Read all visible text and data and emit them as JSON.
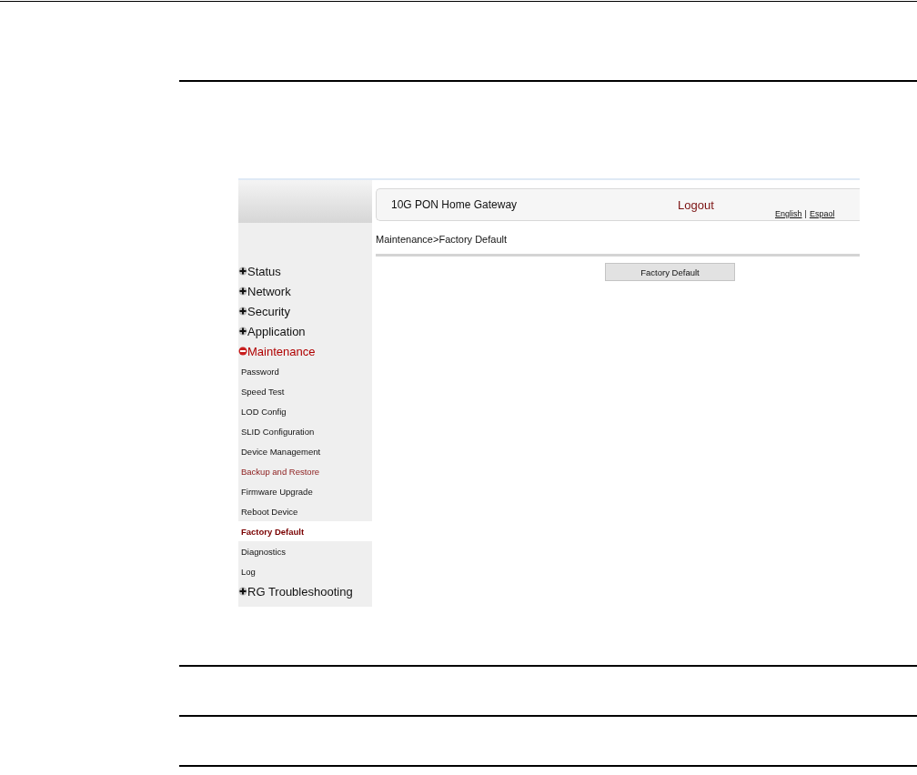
{
  "gateway": {
    "title": "10G PON Home Gateway",
    "logout": "Logout",
    "languages": [
      "English",
      "Espaol"
    ],
    "separator": "|"
  },
  "breadcrumb": "Maintenance>Factory Default",
  "menu": [
    {
      "label": "Status",
      "expanded": false
    },
    {
      "label": "Network",
      "expanded": false
    },
    {
      "label": "Security",
      "expanded": false
    },
    {
      "label": "Application",
      "expanded": false
    },
    {
      "label": "Maintenance",
      "expanded": true,
      "children": [
        {
          "label": "Password",
          "selected": false,
          "highlighted": false
        },
        {
          "label": "Speed Test",
          "selected": false,
          "highlighted": false
        },
        {
          "label": "LOD Config",
          "selected": false,
          "highlighted": false
        },
        {
          "label": "SLID Configuration",
          "selected": false,
          "highlighted": false
        },
        {
          "label": "Device Management",
          "selected": false,
          "highlighted": false
        },
        {
          "label": "Backup and Restore",
          "selected": false,
          "highlighted": true
        },
        {
          "label": "Firmware Upgrade",
          "selected": false,
          "highlighted": false
        },
        {
          "label": "Reboot Device",
          "selected": false,
          "highlighted": false
        },
        {
          "label": "Factory Default",
          "selected": true,
          "highlighted": false
        },
        {
          "label": "Diagnostics",
          "selected": false,
          "highlighted": false
        },
        {
          "label": "Log",
          "selected": false,
          "highlighted": false
        }
      ]
    },
    {
      "label": "RG Troubleshooting",
      "expanded": false
    }
  ],
  "button": "Factory Default"
}
